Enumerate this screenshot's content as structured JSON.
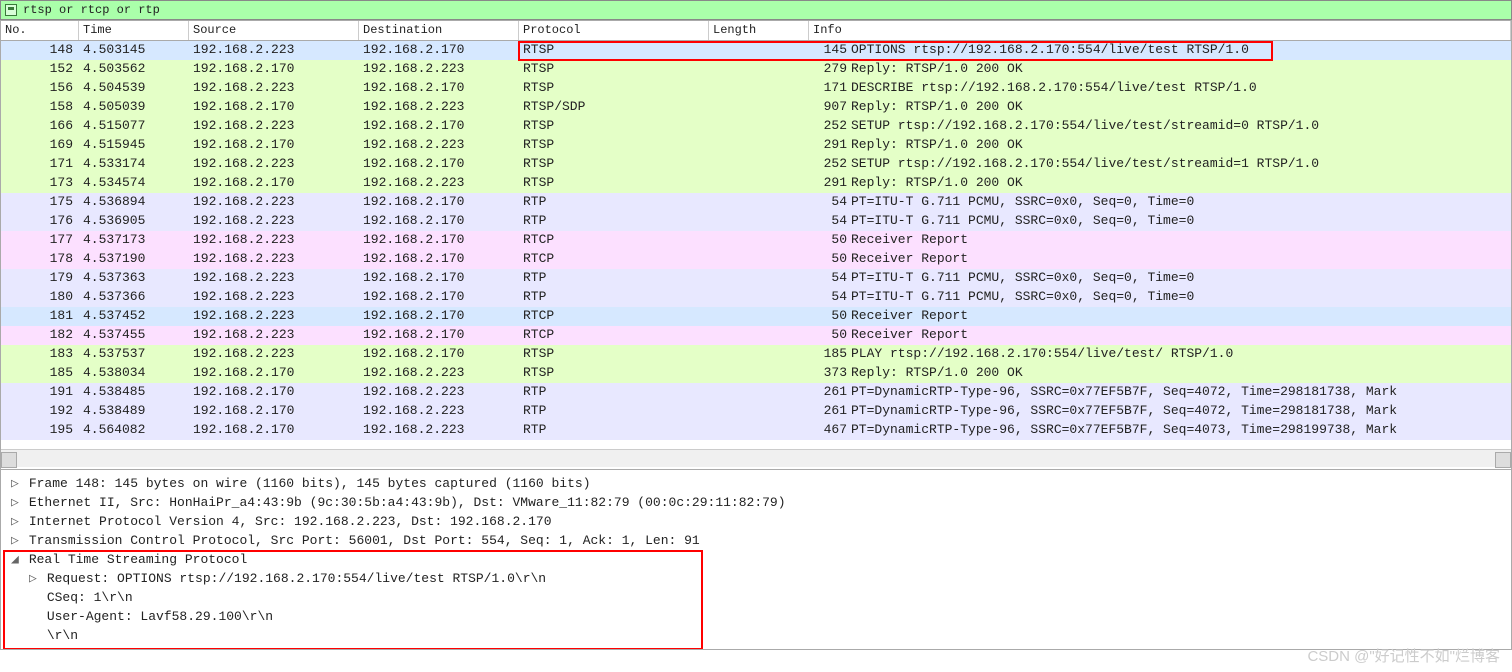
{
  "filter": {
    "expression": "rtsp or rtcp or rtp"
  },
  "columns": {
    "no": "No.",
    "time": "Time",
    "source": "Source",
    "destination": "Destination",
    "protocol": "Protocol",
    "length": "Length",
    "info": "Info"
  },
  "packets": [
    {
      "no": "148",
      "time": "4.503145",
      "src": "192.168.2.223",
      "dst": "192.168.2.170",
      "proto": "RTSP",
      "cls": "sel",
      "len": "145",
      "info": "OPTIONS rtsp://192.168.2.170:554/live/test RTSP/1.0"
    },
    {
      "no": "152",
      "time": "4.503562",
      "src": "192.168.2.170",
      "dst": "192.168.2.223",
      "proto": "RTSP",
      "cls": "rtsp",
      "len": "279",
      "info": "Reply: RTSP/1.0 200 OK"
    },
    {
      "no": "156",
      "time": "4.504539",
      "src": "192.168.2.223",
      "dst": "192.168.2.170",
      "proto": "RTSP",
      "cls": "rtsp",
      "len": "171",
      "info": "DESCRIBE rtsp://192.168.2.170:554/live/test RTSP/1.0"
    },
    {
      "no": "158",
      "time": "4.505039",
      "src": "192.168.2.170",
      "dst": "192.168.2.223",
      "proto": "RTSP/SDP",
      "cls": "rtsp",
      "len": "907",
      "info": "Reply: RTSP/1.0 200 OK"
    },
    {
      "no": "166",
      "time": "4.515077",
      "src": "192.168.2.223",
      "dst": "192.168.2.170",
      "proto": "RTSP",
      "cls": "rtsp",
      "len": "252",
      "info": "SETUP rtsp://192.168.2.170:554/live/test/streamid=0 RTSP/1.0"
    },
    {
      "no": "169",
      "time": "4.515945",
      "src": "192.168.2.170",
      "dst": "192.168.2.223",
      "proto": "RTSP",
      "cls": "rtsp",
      "len": "291",
      "info": "Reply: RTSP/1.0 200 OK"
    },
    {
      "no": "171",
      "time": "4.533174",
      "src": "192.168.2.223",
      "dst": "192.168.2.170",
      "proto": "RTSP",
      "cls": "rtsp",
      "len": "252",
      "info": "SETUP rtsp://192.168.2.170:554/live/test/streamid=1 RTSP/1.0"
    },
    {
      "no": "173",
      "time": "4.534574",
      "src": "192.168.2.170",
      "dst": "192.168.2.223",
      "proto": "RTSP",
      "cls": "rtsp",
      "len": "291",
      "info": "Reply: RTSP/1.0 200 OK"
    },
    {
      "no": "175",
      "time": "4.536894",
      "src": "192.168.2.223",
      "dst": "192.168.2.170",
      "proto": "RTP",
      "cls": "rtp",
      "len": "54",
      "info": "PT=ITU-T G.711 PCMU, SSRC=0x0, Seq=0, Time=0"
    },
    {
      "no": "176",
      "time": "4.536905",
      "src": "192.168.2.223",
      "dst": "192.168.2.170",
      "proto": "RTP",
      "cls": "rtp",
      "len": "54",
      "info": "PT=ITU-T G.711 PCMU, SSRC=0x0, Seq=0, Time=0"
    },
    {
      "no": "177",
      "time": "4.537173",
      "src": "192.168.2.223",
      "dst": "192.168.2.170",
      "proto": "RTCP",
      "cls": "rtcp",
      "len": "50",
      "info": "Receiver Report"
    },
    {
      "no": "178",
      "time": "4.537190",
      "src": "192.168.2.223",
      "dst": "192.168.2.170",
      "proto": "RTCP",
      "cls": "rtcp",
      "len": "50",
      "info": "Receiver Report"
    },
    {
      "no": "179",
      "time": "4.537363",
      "src": "192.168.2.223",
      "dst": "192.168.2.170",
      "proto": "RTP",
      "cls": "rtp",
      "len": "54",
      "info": "PT=ITU-T G.711 PCMU, SSRC=0x0, Seq=0, Time=0"
    },
    {
      "no": "180",
      "time": "4.537366",
      "src": "192.168.2.223",
      "dst": "192.168.2.170",
      "proto": "RTP",
      "cls": "rtp",
      "len": "54",
      "info": "PT=ITU-T G.711 PCMU, SSRC=0x0, Seq=0, Time=0"
    },
    {
      "no": "181",
      "time": "4.537452",
      "src": "192.168.2.223",
      "dst": "192.168.2.170",
      "proto": "RTCP",
      "cls": "sel",
      "len": "50",
      "info": "Receiver Report"
    },
    {
      "no": "182",
      "time": "4.537455",
      "src": "192.168.2.223",
      "dst": "192.168.2.170",
      "proto": "RTCP",
      "cls": "rtcp",
      "len": "50",
      "info": "Receiver Report"
    },
    {
      "no": "183",
      "time": "4.537537",
      "src": "192.168.2.223",
      "dst": "192.168.2.170",
      "proto": "RTSP",
      "cls": "rtsp",
      "len": "185",
      "info": "PLAY rtsp://192.168.2.170:554/live/test/ RTSP/1.0"
    },
    {
      "no": "185",
      "time": "4.538034",
      "src": "192.168.2.170",
      "dst": "192.168.2.223",
      "proto": "RTSP",
      "cls": "rtsp",
      "len": "373",
      "info": "Reply: RTSP/1.0 200 OK"
    },
    {
      "no": "191",
      "time": "4.538485",
      "src": "192.168.2.170",
      "dst": "192.168.2.223",
      "proto": "RTP",
      "cls": "rtp",
      "len": "261",
      "info": "PT=DynamicRTP-Type-96, SSRC=0x77EF5B7F, Seq=4072, Time=298181738, Mark"
    },
    {
      "no": "192",
      "time": "4.538489",
      "src": "192.168.2.170",
      "dst": "192.168.2.223",
      "proto": "RTP",
      "cls": "rtp",
      "len": "261",
      "info": "PT=DynamicRTP-Type-96, SSRC=0x77EF5B7F, Seq=4072, Time=298181738, Mark"
    },
    {
      "no": "195",
      "time": "4.564082",
      "src": "192.168.2.170",
      "dst": "192.168.2.223",
      "proto": "RTP",
      "cls": "rtp",
      "len": "467",
      "info": "PT=DynamicRTP-Type-96, SSRC=0x77EF5B7F, Seq=4073, Time=298199738, Mark"
    }
  ],
  "detail": {
    "lines": [
      {
        "indent": 0,
        "tri": "▷",
        "text": "Frame 148: 145 bytes on wire (1160 bits), 145 bytes captured (1160 bits)"
      },
      {
        "indent": 0,
        "tri": "▷",
        "text": "Ethernet II, Src: HonHaiPr_a4:43:9b (9c:30:5b:a4:43:9b), Dst: VMware_11:82:79 (00:0c:29:11:82:79)"
      },
      {
        "indent": 0,
        "tri": "▷",
        "text": "Internet Protocol Version 4, Src: 192.168.2.223, Dst: 192.168.2.170"
      },
      {
        "indent": 0,
        "tri": "▷",
        "text": "Transmission Control Protocol, Src Port: 56001, Dst Port: 554, Seq: 1, Ack: 1, Len: 91"
      },
      {
        "indent": 0,
        "tri": "◢",
        "text": "Real Time Streaming Protocol"
      },
      {
        "indent": 1,
        "tri": "▷",
        "text": "Request: OPTIONS rtsp://192.168.2.170:554/live/test RTSP/1.0\\r\\n"
      },
      {
        "indent": 1,
        "tri": "",
        "text": "CSeq: 1\\r\\n"
      },
      {
        "indent": 1,
        "tri": "",
        "text": "User-Agent: Lavf58.29.100\\r\\n"
      },
      {
        "indent": 1,
        "tri": "",
        "text": "\\r\\n"
      }
    ]
  },
  "watermark": "CSDN @\"好记性不如\"烂博客"
}
